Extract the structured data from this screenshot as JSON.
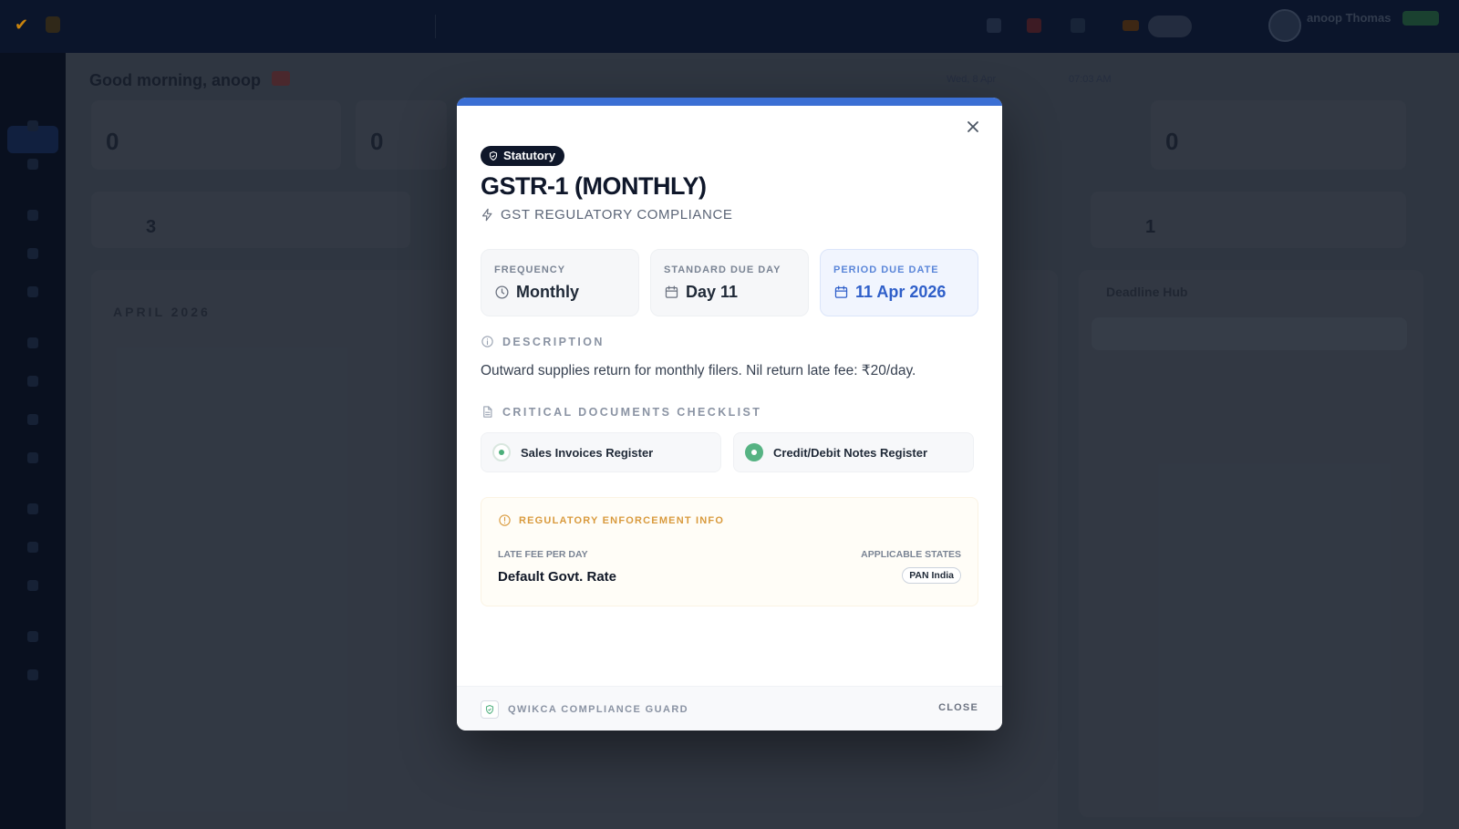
{
  "background": {
    "greeting": "Good morning, anoop",
    "user_name": "anoop Thomas",
    "stats_top": [
      "0",
      "0",
      "0"
    ],
    "stats_second": [
      "3",
      "1"
    ],
    "calendar_title": "APRIL 2026",
    "deadline_hub_title": "Deadline Hub",
    "header_chips": [
      "Wed, 8 Apr",
      "07:03 AM"
    ]
  },
  "modal": {
    "tag_label": "Statutory",
    "title": "GSTR-1 (MONTHLY)",
    "subtitle": "GST REGULATORY COMPLIANCE",
    "info": {
      "frequency_label": "FREQUENCY",
      "frequency_value": "Monthly",
      "due_day_label": "STANDARD DUE DAY",
      "due_day_value": "Day 11",
      "period_label": "PERIOD DUE DATE",
      "period_value": "11 Apr 2026"
    },
    "description_heading": "DESCRIPTION",
    "description_text": "Outward supplies return for monthly filers. Nil return late fee: ₹20/day.",
    "checklist_heading": "CRITICAL DOCUMENTS CHECKLIST",
    "checklist": [
      {
        "label": "Sales Invoices Register"
      },
      {
        "label": "Credit/Debit Notes Register"
      }
    ],
    "enforcement": {
      "heading": "REGULATORY ENFORCEMENT INFO",
      "late_fee_label": "LATE FEE PER DAY",
      "late_fee_value": "Default Govt. Rate",
      "states_label": "APPLICABLE STATES",
      "states_value": "PAN India"
    },
    "footer_brand": "QWIKCA COMPLIANCE GUARD",
    "footer_close": "CLOSE"
  },
  "colors": {
    "accent": "#3b6fd4",
    "warning": "#d99a3d",
    "success": "#56b383",
    "dark": "#0f172a"
  },
  "icons": [
    "close-icon",
    "shield-icon",
    "lightning-icon",
    "clock-icon",
    "calendar-icon",
    "info-icon",
    "document-icon",
    "alert-circle-icon"
  ]
}
